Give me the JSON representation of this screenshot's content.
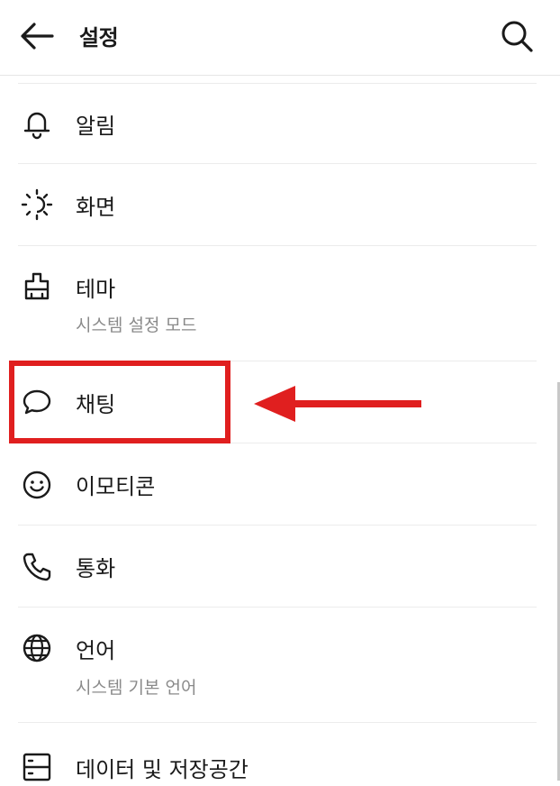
{
  "header": {
    "back_icon": "arrow-left-icon",
    "title": "설정",
    "search_icon": "search-icon"
  },
  "settings": [
    {
      "id": "notifications",
      "icon": "bell-icon",
      "label": "알림",
      "sub": ""
    },
    {
      "id": "screen",
      "icon": "brightness-icon",
      "label": "화면",
      "sub": ""
    },
    {
      "id": "theme",
      "icon": "paint-brush-icon",
      "label": "테마",
      "sub": "시스템 설정 모드"
    },
    {
      "id": "chat",
      "icon": "chat-bubble-icon",
      "label": "채팅",
      "sub": ""
    },
    {
      "id": "emoticon",
      "icon": "smiley-icon",
      "label": "이모티콘",
      "sub": ""
    },
    {
      "id": "call",
      "icon": "phone-icon",
      "label": "통화",
      "sub": ""
    },
    {
      "id": "language",
      "icon": "globe-icon",
      "label": "언어",
      "sub": "시스템 기본 언어"
    },
    {
      "id": "storage",
      "icon": "storage-icon",
      "label": "데이터 및 저장공간",
      "sub": ""
    }
  ],
  "annotation": {
    "highlight_color": "#e01f1f",
    "highlighted_item": "채팅"
  }
}
